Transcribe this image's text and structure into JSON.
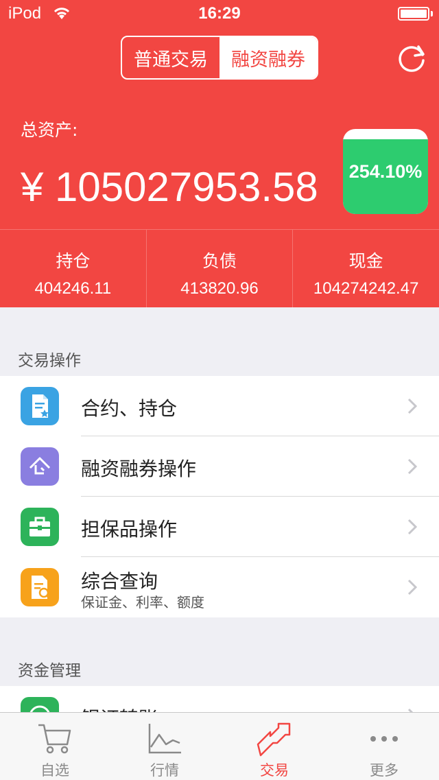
{
  "status_bar": {
    "carrier": "iPod",
    "time": "16:29"
  },
  "header": {
    "segments": [
      {
        "label": "普通交易",
        "selected": false
      },
      {
        "label": "融资融券",
        "selected": true
      }
    ],
    "refresh_icon": "refresh-icon"
  },
  "summary": {
    "total_label": "总资产:",
    "total_value": "¥ 105027953.58",
    "ratio_text": "254.10%",
    "stats": [
      {
        "label": "持仓",
        "value": "404246.11"
      },
      {
        "label": "负债",
        "value": "413820.96"
      },
      {
        "label": "现金",
        "value": "104274242.47"
      }
    ]
  },
  "sections": [
    {
      "title": "交易操作",
      "items": [
        {
          "label": "合约、持仓",
          "icon": "contract-document-icon",
          "color": "#3aa3e3"
        },
        {
          "label": "融资融券操作",
          "icon": "warehouse-icon",
          "color": "#8a7ee0"
        },
        {
          "label": "担保品操作",
          "icon": "briefcase-icon",
          "color": "#2db35a"
        },
        {
          "label": "综合查询",
          "sublabel": "保证金、利率、额度",
          "icon": "search-document-icon",
          "color": "#f7a21b"
        }
      ]
    },
    {
      "title": "资金管理",
      "items": [
        {
          "label": "银证转账",
          "icon": "transfer-icon",
          "color": "#2db35a"
        }
      ]
    }
  ],
  "tabbar": [
    {
      "label": "自选",
      "icon": "cart-icon",
      "active": false
    },
    {
      "label": "行情",
      "icon": "chart-icon",
      "active": false
    },
    {
      "label": "交易",
      "icon": "trade-arrows-icon",
      "active": true
    },
    {
      "label": "更多",
      "icon": "more-dots-icon",
      "active": false
    }
  ],
  "colors": {
    "brand_red": "#f24642",
    "ratio_green": "#2dcc6f"
  }
}
